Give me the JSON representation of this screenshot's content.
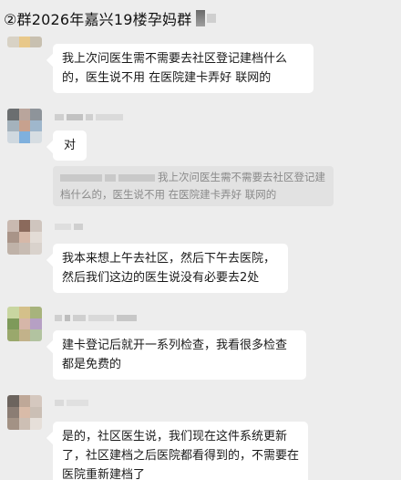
{
  "header": {
    "title": "②群2026年嘉兴19楼孕妈群"
  },
  "messages": [
    {
      "text": "我上次问医生需不需要去社区登记建档什么的，医生说不用 在医院建卡弄好 联网的"
    },
    {
      "text": "对"
    },
    {
      "quote": "我上次问医生需不需要去社区登记建档什么的，医生说不用 在医院建卡弄好 联网的"
    },
    {
      "text": "我本来想上午去社区，然后下午去医院，然后我们这边的医生说没有必要去2处"
    },
    {
      "text": "建卡登记后就开一系列检查，我看很多检查都是免费的"
    },
    {
      "text": "是的，社区医生说，我们现在这件系统更新了，社区建档之后医院都看得到的，不需要在医院重新建档了"
    }
  ],
  "colors": {
    "background": "#ededed",
    "bubble": "#ffffff",
    "quote_bg": "#e2e2e2",
    "quote_text": "#8a8a8a"
  },
  "icons": [
    "avatar",
    "avatar",
    "avatar",
    "avatar",
    "avatar"
  ]
}
